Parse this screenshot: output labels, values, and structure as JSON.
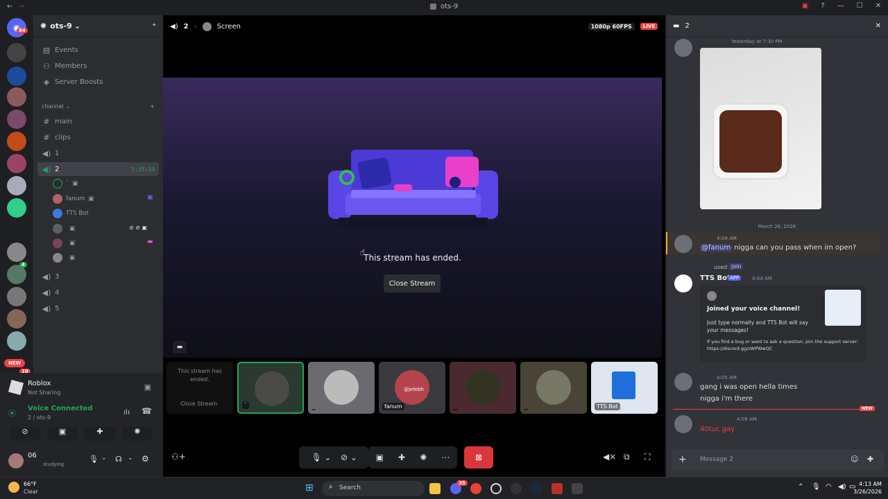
{
  "window": {
    "title": "ots-9"
  },
  "guilds": {
    "mention_count": "84",
    "new_label": "NEW",
    "count_bottom": "10",
    "count_small": "4"
  },
  "server": {
    "name": "ots-9",
    "top_items": [
      {
        "icon": "calendar-icon",
        "label": "Events"
      },
      {
        "icon": "members-icon",
        "label": "Members"
      },
      {
        "icon": "boost-icon",
        "label": "Server Boosts"
      }
    ],
    "category": "channel",
    "channels": [
      {
        "type": "text",
        "label": "main"
      },
      {
        "type": "text",
        "label": "clips"
      },
      {
        "type": "voice",
        "label": "1"
      },
      {
        "type": "voice",
        "label": "2",
        "timer": "5:35:14"
      },
      {
        "type": "voice",
        "label": "3"
      },
      {
        "type": "voice",
        "label": "4"
      },
      {
        "type": "voice",
        "label": "5"
      }
    ],
    "voice_users": [
      {
        "name": "`"
      },
      {
        "name": "fanum"
      },
      {
        "name": "TTS Bot"
      },
      {
        "name": ""
      },
      {
        "name": ""
      },
      {
        "name": ""
      }
    ]
  },
  "activity": {
    "game": "Roblox",
    "status": "Not Sharing"
  },
  "voice": {
    "status": "Voice Connected",
    "location": "2 / ots-9"
  },
  "user": {
    "name": "06",
    "status": "studying"
  },
  "stage": {
    "voice_count": "2",
    "stream_name": "Screen",
    "quality": "1080p 60FPS",
    "live": "LIVE",
    "ended_text": "This stream has ended.",
    "close_button": "Close Stream",
    "tiles": [
      {
        "label": "This stream has ended.",
        "action": "Close Stream"
      },
      {
        "label": "`"
      },
      {
        "label": ""
      },
      {
        "label": "fanum",
        "tag": "@jefebh"
      },
      {
        "label": ""
      },
      {
        "label": ""
      },
      {
        "label": "TTS Bot"
      }
    ]
  },
  "chat": {
    "count": "2",
    "messages": [
      {
        "time": "Yesterday at 7:30 PM"
      },
      {
        "date_divider": "March 26, 2026"
      },
      {
        "time": "4:04 AM",
        "mention": "@fanum",
        "text": "nigga can you pass when im open?"
      },
      {
        "used_label": "used",
        "command": "join",
        "author": "TTS Bot",
        "app_badge": "APP",
        "time": "4:04 AM",
        "embed_title": "Joined your voice channel!",
        "embed_body": "Just type normally and TTS Bot will say your messages!",
        "embed_footer": "If you find a bug or want to ask a question, join the support server: https://discord.gg/zWPWwQC"
      },
      {
        "time": "4:05 AM",
        "line1": "gang i was open hella times",
        "line2": "nigga i'm there"
      },
      {
        "new_label": "NEW"
      },
      {
        "time": "4:09 AM",
        "text": "40tuc gay"
      }
    ],
    "input_placeholder": "Message 2"
  },
  "taskbar": {
    "weather_temp": "66°F",
    "weather_cond": "Clear",
    "search": "Search",
    "discord_badge": "35",
    "time": "4:13 AM",
    "date": "3/26/2026"
  },
  "colors": {
    "accent": "#5865f2",
    "live": "#f23f43",
    "voice_green": "#23a55a",
    "mention": "#f0b232"
  }
}
